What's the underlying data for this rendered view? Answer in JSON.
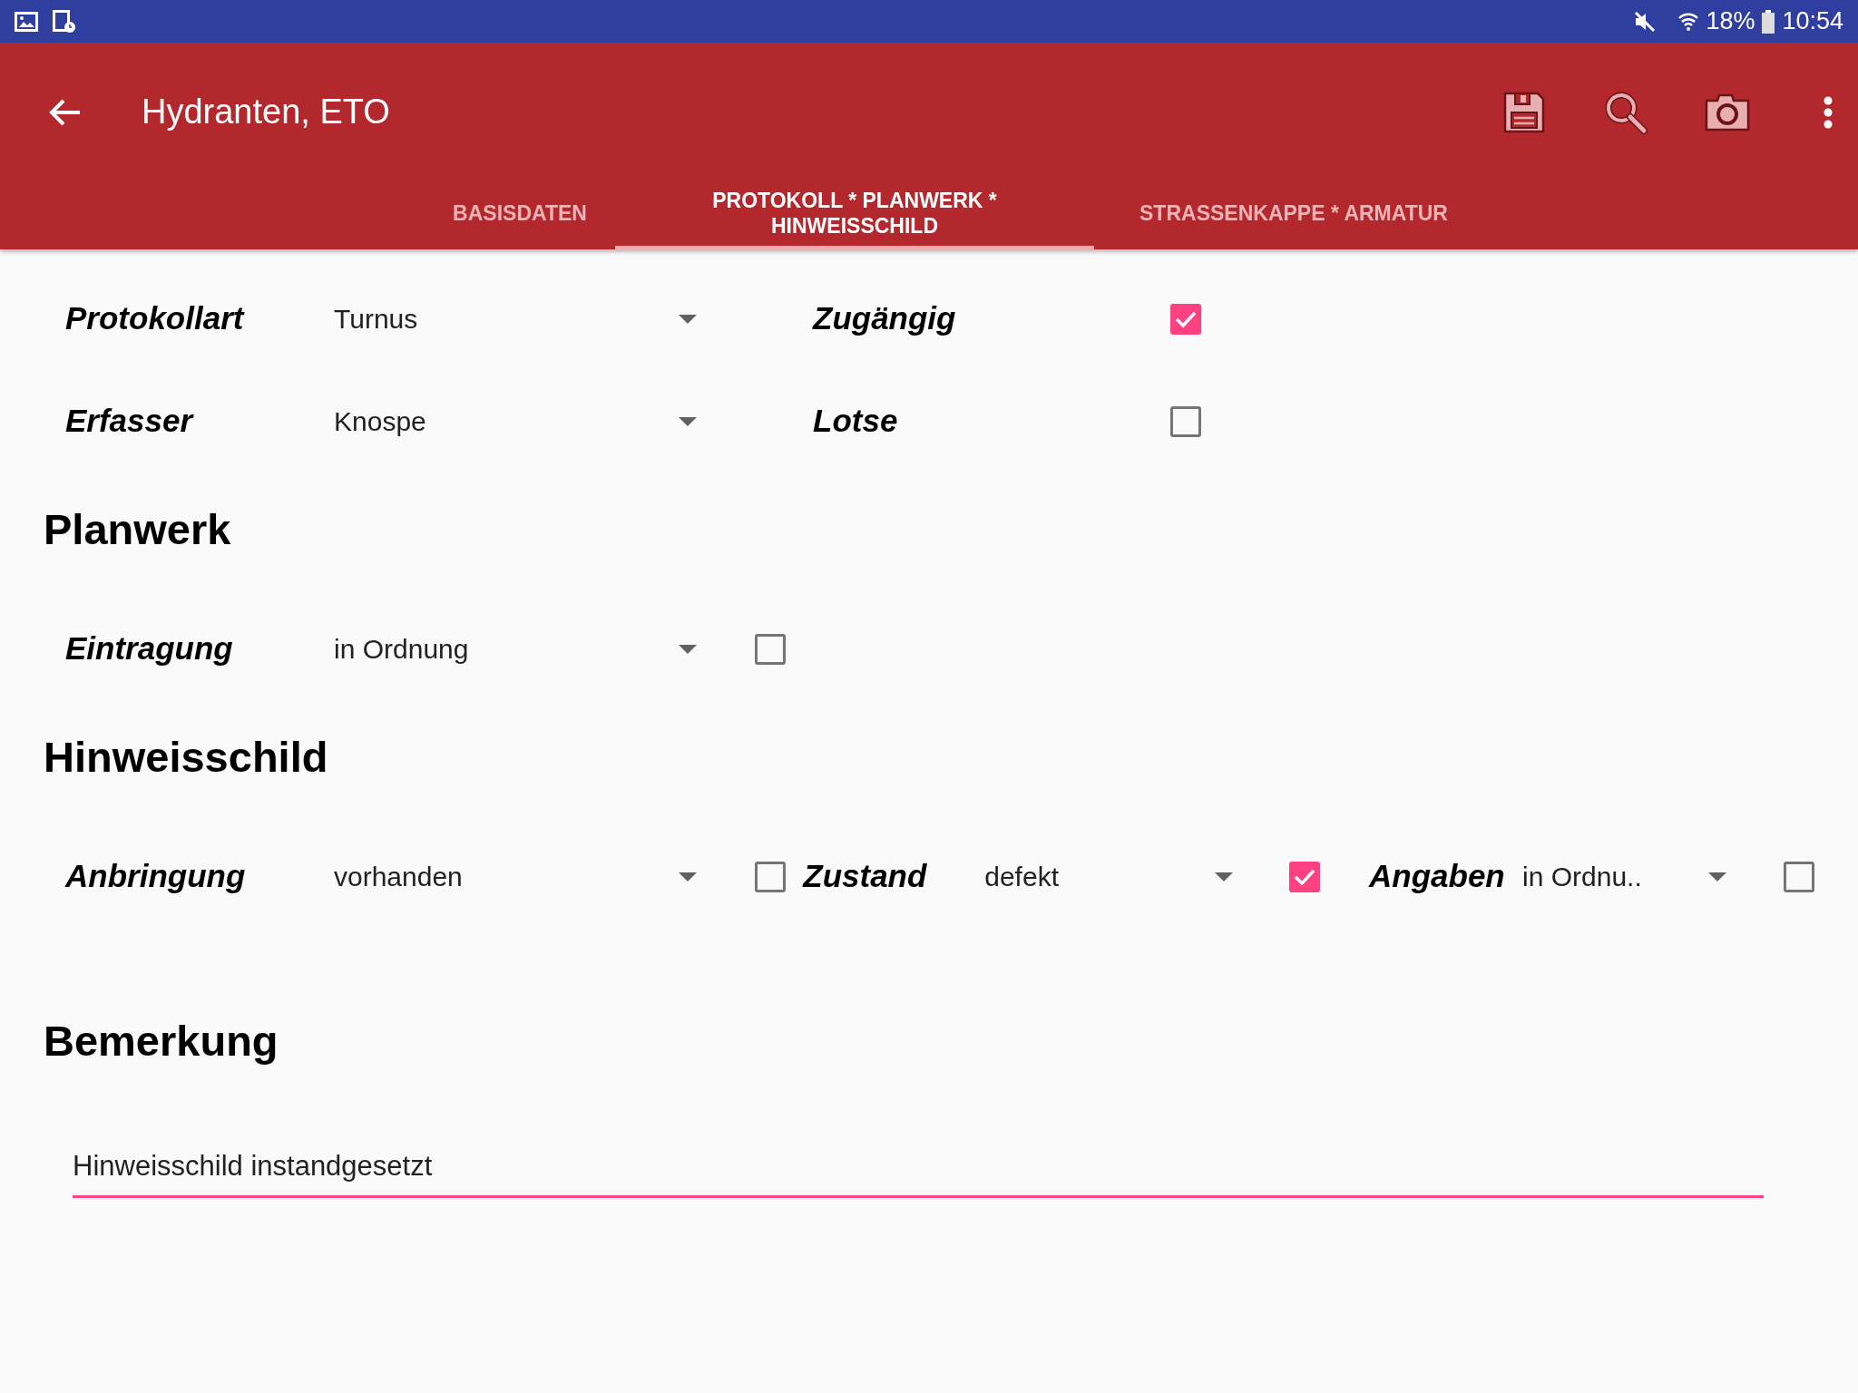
{
  "status_bar": {
    "battery": "18%",
    "time": "10:54"
  },
  "app_bar": {
    "title": "Hydranten, ETO"
  },
  "tabs": [
    {
      "label": "BASISDATEN",
      "selected": false
    },
    {
      "label": "PROTOKOLL * PLANWERK * HINWEISSCHILD",
      "selected": true
    },
    {
      "label": "STRASSENKAPPE * ARMATUR",
      "selected": false
    }
  ],
  "sections": [
    {
      "rows": [
        [
          {
            "kind": "dropdown",
            "label": "Protokollart",
            "value": "Turnus"
          },
          {
            "kind": "checkbox",
            "label": "Zugängig",
            "checked": true
          }
        ],
        [
          {
            "kind": "dropdown",
            "label": "Erfasser",
            "value": "Knospe"
          },
          {
            "kind": "checkbox",
            "label": "Lotse",
            "checked": false
          }
        ]
      ]
    },
    {
      "heading": "Planwerk",
      "rows": [
        [
          {
            "kind": "dropdown",
            "label": "Eintragung",
            "value": "in Ordnung",
            "checked": false
          }
        ]
      ]
    },
    {
      "heading": "Hinweisschild",
      "rows": [
        [
          {
            "kind": "dropdown",
            "label": "Anbringung",
            "value": "vorhanden",
            "checked": false
          },
          {
            "kind": "dropdown",
            "label": "Zustand",
            "value": "defekt",
            "checked": true
          },
          {
            "kind": "dropdown",
            "label": "Angaben",
            "value": "in Ordnu..",
            "checked": false
          }
        ]
      ]
    }
  ],
  "remark": {
    "heading": "Bemerkung",
    "value": "Hinweisschild instandgesetzt",
    "focused": true
  }
}
